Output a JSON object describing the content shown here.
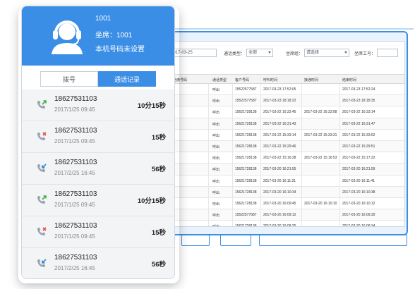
{
  "agent": {
    "id_line": "1001",
    "seat_line": "坐席：1001",
    "number_status": "本机号码未设置"
  },
  "tabs": [
    {
      "label": "拨号",
      "active": false
    },
    {
      "label": "通话记录",
      "active": true
    }
  ],
  "call_log": [
    {
      "number": "18627531103",
      "date": "2017/1/25 09:45",
      "duration": "10分15秒",
      "type": "outgoing"
    },
    {
      "number": "18627531103",
      "date": "2017/1/25 09:45",
      "duration": "15秒",
      "type": "missed"
    },
    {
      "number": "18627531103",
      "date": "2017/2/25 16:45",
      "duration": "56秒",
      "type": "incoming"
    },
    {
      "number": "18627531103",
      "date": "2017/1/25 09:45",
      "duration": "10分15秒",
      "type": "outgoing"
    },
    {
      "number": "18627531103",
      "date": "2017/1/25 09:45",
      "duration": "15秒",
      "type": "missed"
    },
    {
      "number": "18627531103",
      "date": "2017/2/25 16:45",
      "duration": "56秒",
      "type": "incoming"
    }
  ],
  "filters": {
    "date_value": "2017-03-25",
    "call_type_label": "通话类型：",
    "call_type_value": "全部",
    "seat_group_label": "坐席组：",
    "seat_group_value": "请选择",
    "seat_id_label": "坐席工号："
  },
  "table": {
    "headers": [
      "坐席号码",
      "通话类型",
      "客户号码",
      "呼叫时间",
      "接通时间",
      "结束时间"
    ],
    "rows": [
      [
        "呼出",
        "15522577587",
        "2017-03-23 17:52:05",
        "",
        "2017-03-23 17:52:24"
      ],
      [
        "呼出",
        "15522577587",
        "2017-03-23 18:18:22",
        "",
        "2017-03-23 18:18:35"
      ],
      [
        "呼出",
        "15621728138",
        "2017-03-22 16:32:45",
        "2017-03-22 16:33:08",
        "2017-03-22 16:33:14"
      ],
      [
        "呼出",
        "15621728138",
        "2017-03-22 16:31:43",
        "",
        "2017-03-22 16:31:47"
      ],
      [
        "呼出",
        "15621728138",
        "2017-03-22 15:33:14",
        "2017-03-22 15:33:31",
        "2017-03-22 15:33:52"
      ],
      [
        "呼出",
        "15621728138",
        "2017-03-22 15:29:46",
        "",
        "2017-03-22 15:29:51"
      ],
      [
        "呼出",
        "15621728138",
        "2017-03-22 15:16:28",
        "2017-03-22 15:16:53",
        "2017-03-22 15:17:22"
      ],
      [
        "呼出",
        "15621728138",
        "2017-03-20 16:21:55",
        "",
        "2017-03-20 16:21:59"
      ],
      [
        "呼出",
        "15621728138",
        "2017-03-20 16:11:21",
        "",
        "2017-03-20 16:11:41"
      ],
      [
        "呼出",
        "15621728138",
        "2017-03-20 16:10:34",
        "",
        "2017-03-20 16:10:38"
      ],
      [
        "呼出",
        "15621728138",
        "2017-03-20 16:09:45",
        "2017-03-20 16:10:10",
        "2017-03-20 16:10:12"
      ],
      [
        "呼出",
        "15522577587",
        "2017-03-20 16:09:12",
        "",
        "2017-03-20 16:09:30"
      ],
      [
        "呼出",
        "15621728138",
        "2017-03-20 16:08:25",
        "",
        "2017-03-20 16:08:34"
      ]
    ]
  },
  "colors": {
    "accent": "#3a8ee6",
    "outgoing_arrow": "#3fae49",
    "missed_mark": "#e04b3c",
    "incoming_arrow": "#2f86d9"
  },
  "icons": {
    "avatar": "headset-agent-icon",
    "outgoing": "phone-outgoing-icon",
    "missed": "phone-missed-icon",
    "incoming": "phone-incoming-icon",
    "dropdown": "chevron-down-icon"
  }
}
